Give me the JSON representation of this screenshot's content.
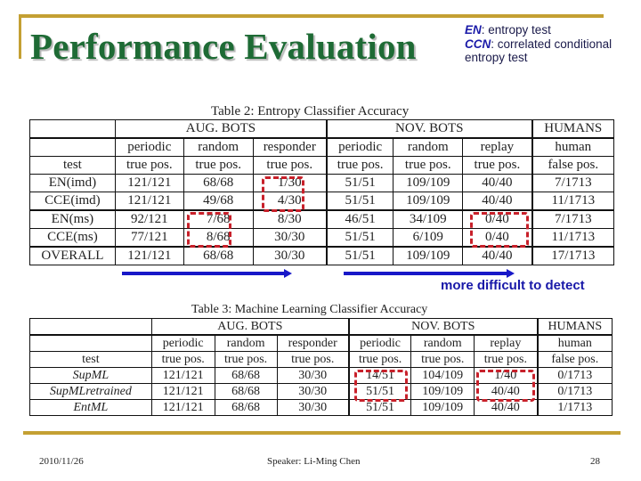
{
  "slide": {
    "title": "Performance Evaluation",
    "legend": [
      {
        "abbr": "EN",
        "sep": ": ",
        "text": "entropy test"
      },
      {
        "abbr": "CCN",
        "sep": ": ",
        "text": "correlated conditional entropy test"
      }
    ],
    "annotation": "more difficult to detect",
    "colors": {
      "title": "#1E6B35",
      "accent_gold": "#C4A033",
      "highlight_red": "#C8202A",
      "arrow_blue": "#1818C8"
    }
  },
  "table2": {
    "caption": "Table 2: Entropy Classifier Accuracy",
    "groups": [
      "AUG. BOTS",
      "NOV. BOTS",
      "HUMANS"
    ],
    "subheaders": [
      "periodic",
      "random",
      "responder",
      "periodic",
      "random",
      "replay",
      "human"
    ],
    "metric_label": "test",
    "metrics": [
      "true pos.",
      "true pos.",
      "true pos.",
      "true pos.",
      "true pos.",
      "true pos.",
      "false pos."
    ],
    "rows": [
      {
        "test": "EN(imd)",
        "values": [
          "121/121",
          "68/68",
          "1/30",
          "51/51",
          "109/109",
          "40/40",
          "7/1713"
        ]
      },
      {
        "test": "CCE(imd)",
        "values": [
          "121/121",
          "49/68",
          "4/30",
          "51/51",
          "109/109",
          "40/40",
          "11/1713"
        ]
      },
      {
        "test": "EN(ms)",
        "values": [
          "92/121",
          "7/68",
          "8/30",
          "46/51",
          "34/109",
          "0/40",
          "7/1713"
        ]
      },
      {
        "test": "CCE(ms)",
        "values": [
          "77/121",
          "8/68",
          "30/30",
          "51/51",
          "6/109",
          "0/40",
          "11/1713"
        ]
      },
      {
        "test": "OVERALL",
        "values": [
          "121/121",
          "68/68",
          "30/30",
          "51/51",
          "109/109",
          "40/40",
          "17/1713"
        ]
      }
    ],
    "highlights": [
      {
        "column": "responder (AUG)",
        "rows": [
          "EN(imd)",
          "CCE(imd)"
        ]
      },
      {
        "column": "random (AUG)",
        "rows": [
          "EN(ms)",
          "CCE(ms)"
        ]
      },
      {
        "column": "replay (NOV)",
        "rows": [
          "EN(ms)",
          "CCE(ms)"
        ]
      }
    ]
  },
  "table3": {
    "caption": "Table 3: Machine Learning Classifier Accuracy",
    "groups": [
      "AUG. BOTS",
      "NOV. BOTS",
      "HUMANS"
    ],
    "subheaders": [
      "periodic",
      "random",
      "responder",
      "periodic",
      "random",
      "replay",
      "human"
    ],
    "metric_label": "test",
    "metrics": [
      "true pos.",
      "true pos.",
      "true pos.",
      "true pos.",
      "true pos.",
      "true pos.",
      "false pos."
    ],
    "rows": [
      {
        "test": "SupML",
        "values": [
          "121/121",
          "68/68",
          "30/30",
          "14/51",
          "104/109",
          "1/40",
          "0/1713"
        ]
      },
      {
        "test": "SupMLretrained",
        "values": [
          "121/121",
          "68/68",
          "30/30",
          "51/51",
          "109/109",
          "40/40",
          "0/1713"
        ]
      },
      {
        "test": "EntML",
        "values": [
          "121/121",
          "68/68",
          "30/30",
          "51/51",
          "109/109",
          "40/40",
          "1/1713"
        ]
      }
    ],
    "highlights": [
      {
        "column": "periodic (NOV)",
        "rows": [
          "SupML",
          "SupMLretrained"
        ]
      },
      {
        "column": "replay (NOV)",
        "rows": [
          "SupML",
          "SupMLretrained"
        ]
      }
    ]
  },
  "footer": {
    "date": "2010/11/26",
    "speaker": "Speaker: Li-Ming Chen",
    "page": "28"
  }
}
